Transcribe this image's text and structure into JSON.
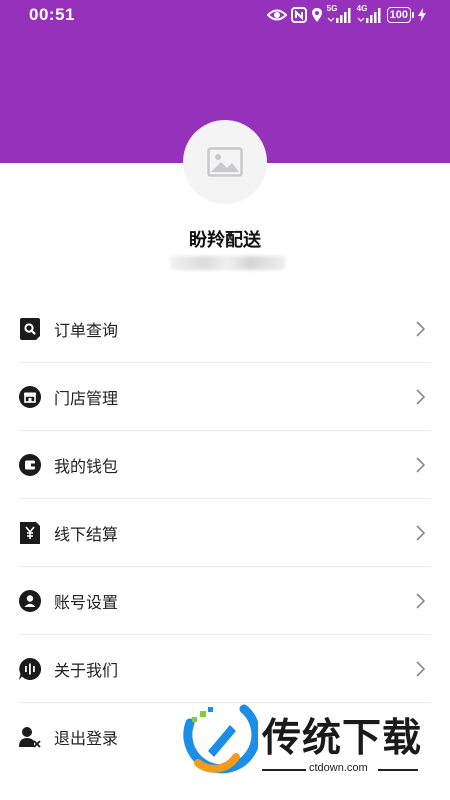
{
  "status_bar": {
    "time": "00:51",
    "signal1_label": "5G",
    "signal2_label": "4G",
    "battery": "100"
  },
  "profile": {
    "name": "盼羚配送",
    "avatar_icon": "image-placeholder-icon"
  },
  "menu": [
    {
      "label": "订单查询",
      "icon": "search-order-icon"
    },
    {
      "label": "门店管理",
      "icon": "store-icon"
    },
    {
      "label": "我的钱包",
      "icon": "wallet-icon"
    },
    {
      "label": "线下结算",
      "icon": "yen-receipt-icon"
    },
    {
      "label": "账号设置",
      "icon": "account-icon"
    },
    {
      "label": "关于我们",
      "icon": "about-chat-icon"
    },
    {
      "label": "退出登录",
      "icon": "logout-user-icon"
    }
  ],
  "watermark": {
    "title": "传统下载",
    "url": "ctdown.com"
  },
  "colors": {
    "header": "#9531bb",
    "divider": "#ececec"
  }
}
